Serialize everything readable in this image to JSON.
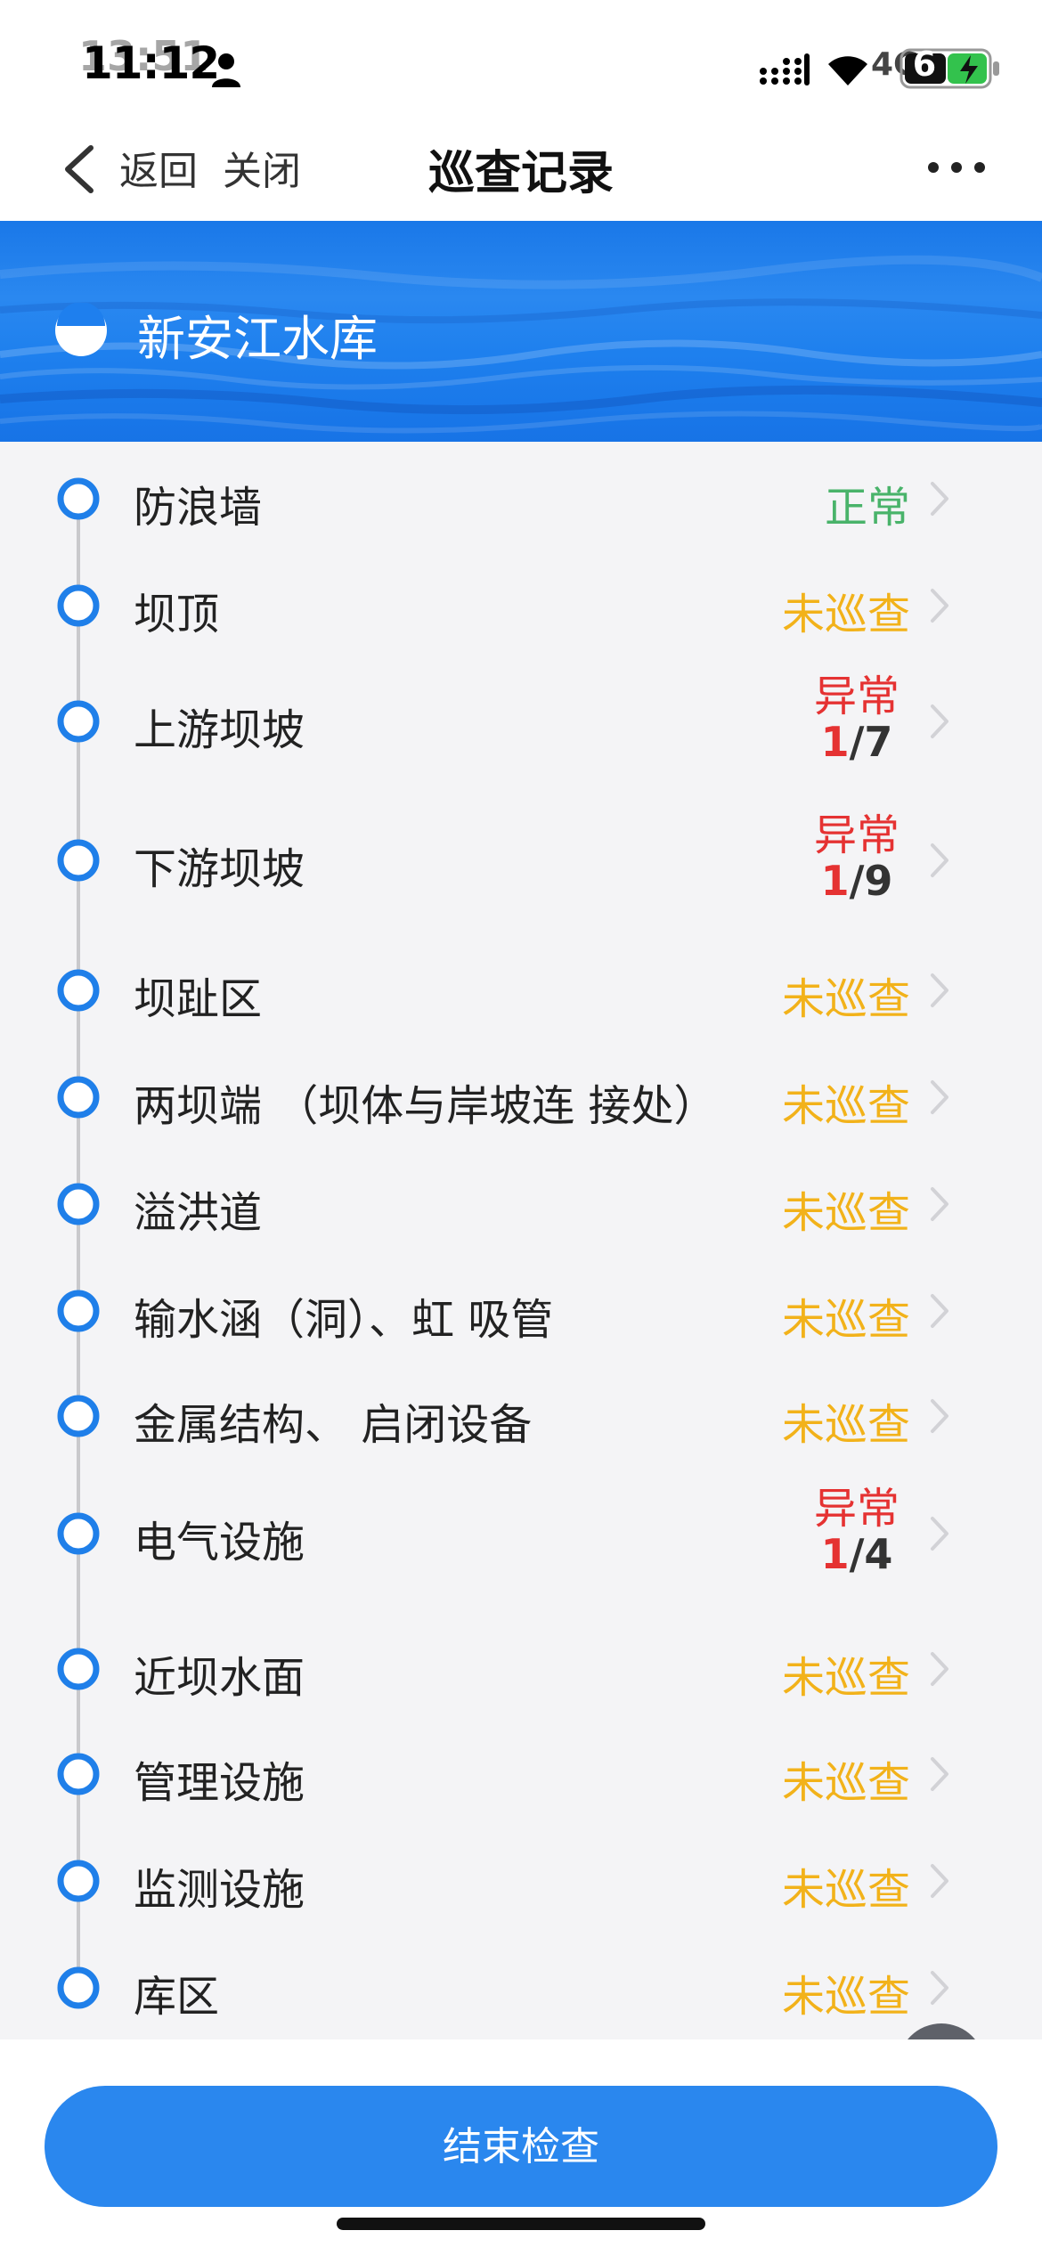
{
  "status_bar": {
    "time": "11:12",
    "time_overlay": "13:51",
    "network": "4G",
    "battery": "6"
  },
  "nav": {
    "back_label": "返回",
    "close_label": "关闭",
    "title": "巡查记录"
  },
  "banner": {
    "reservoir_name": "新安江水库"
  },
  "items": [
    {
      "label": "防浪墙",
      "status": "正常",
      "type": "normal"
    },
    {
      "label": "坝顶",
      "status": "未巡查",
      "type": "pending"
    },
    {
      "label": "上游坝坡",
      "status": "异常",
      "type": "abnormal",
      "abnormal_count": "1",
      "total": "/7"
    },
    {
      "label": "下游坝坡",
      "status": "异常",
      "type": "abnormal",
      "abnormal_count": "1",
      "total": "/9"
    },
    {
      "label": "坝趾区",
      "status": "未巡查",
      "type": "pending"
    },
    {
      "label": "两坝端 （坝体与岸坡连 接处）",
      "status": "未巡查",
      "type": "pending"
    },
    {
      "label": "溢洪道",
      "status": "未巡查",
      "type": "pending"
    },
    {
      "label": "输水涵（洞）、虹 吸管",
      "status": "未巡查",
      "type": "pending"
    },
    {
      "label": "金属结构、 启闭设备",
      "status": "未巡查",
      "type": "pending"
    },
    {
      "label": "电气设施",
      "status": "异常",
      "type": "abnormal",
      "abnormal_count": "1",
      "total": "/4"
    },
    {
      "label": "近坝水面",
      "status": "未巡查",
      "type": "pending"
    },
    {
      "label": "管理设施",
      "status": "未巡查",
      "type": "pending"
    },
    {
      "label": "监测设施",
      "status": "未巡查",
      "type": "pending"
    },
    {
      "label": "库区",
      "status": "未巡查",
      "type": "pending"
    }
  ],
  "footer": {
    "end_button_label": "结束检查"
  },
  "colors": {
    "primary": "#2a87ee",
    "normal": "#49b36a",
    "pending": "#f2b21a",
    "abnormal": "#e53232"
  },
  "icons": [
    "person-icon",
    "signal-icon",
    "wifi-icon",
    "battery-icon",
    "back-icon",
    "more-icon",
    "reservoir-icon",
    "timeline-dot-icon",
    "chevron-right-icon",
    "text-scan-icon"
  ]
}
